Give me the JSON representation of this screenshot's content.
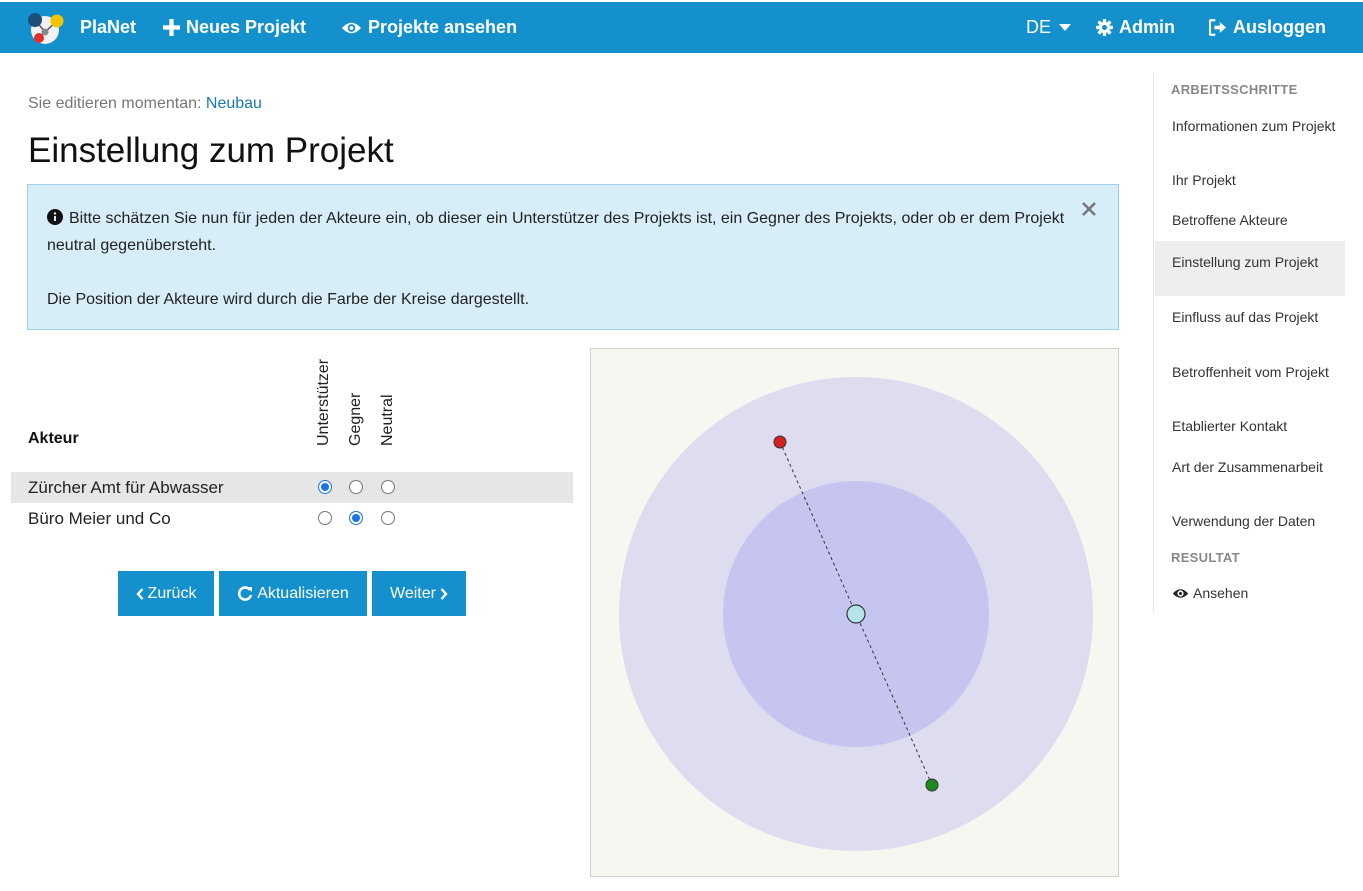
{
  "navbar": {
    "brand": "PlaNet",
    "new_project": "Neues Projekt",
    "view_projects": "Projekte ansehen",
    "language": "DE",
    "admin": "Admin",
    "logout": "Ausloggen"
  },
  "main": {
    "editing_prefix": "Sie editieren momentan:",
    "editing_project": "Neubau",
    "title": "Einstellung zum Projekt",
    "alert": {
      "line1": "Bitte schätzen Sie nun für jeden der Akteure ein, ob dieser ein Unterstützer des Projekts ist, ein Gegner des Projekts, oder ob er dem Projekt neutral gegenübersteht.",
      "line2": "Die Position der Akteure wird durch die Farbe der Kreise dargestellt.",
      "close": "×"
    },
    "table": {
      "akteur_header": "Akteur",
      "columns": [
        "Unterstützer",
        "Gegner",
        "Neutral"
      ],
      "rows": [
        {
          "name": "Zürcher Amt für Abwasser",
          "selected": "Unterstützer"
        },
        {
          "name": "Büro Meier und Co",
          "selected": "Gegner"
        }
      ]
    },
    "buttons": {
      "back": "Zurück",
      "refresh": "Aktualisieren",
      "next": "Weiter"
    }
  },
  "sidebar": {
    "section1": "ARBEITSSCHRITTE",
    "items": [
      "Informationen zum Projekt",
      "Ihr Projekt",
      "Betroffene Akteure",
      "Einstellung zum Projekt",
      "Einfluss auf das Projekt",
      "Betroffenheit vom Projekt",
      "Etablierter Kontakt",
      "Art der Zusammenarbeit",
      "Verwendung der Daten"
    ],
    "active_item": "Einstellung zum Projekt",
    "section2": "RESULTAT",
    "result_item": "Ansehen"
  },
  "colors": {
    "primary": "#1491cc",
    "alert_bg": "#d7eef9",
    "supporter_node": "#1e8a1e",
    "opponent_node": "#d42020",
    "center_node": "#b5e3ea",
    "outer_ring": "#dedcef",
    "inner_ring": "#c6c5ef"
  }
}
